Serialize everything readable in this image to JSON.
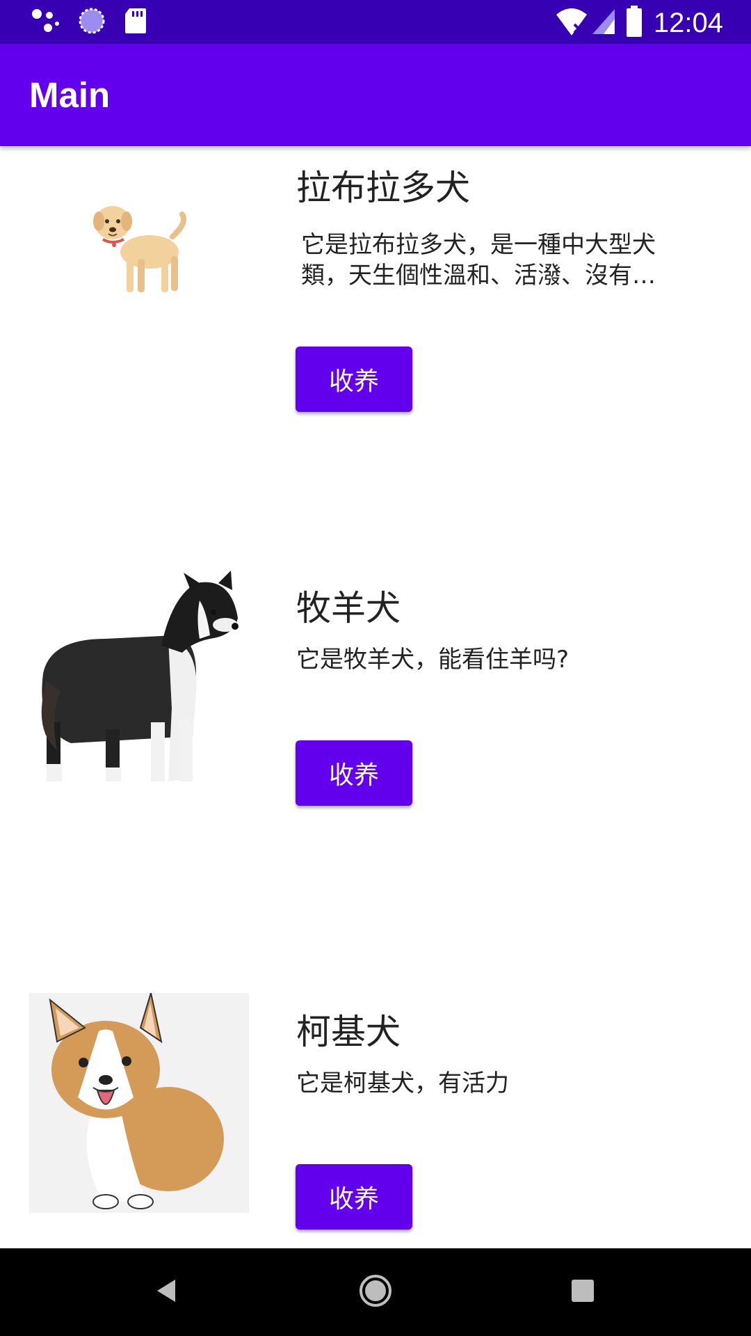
{
  "status_bar": {
    "time": "12:04",
    "icons_left": [
      "assistant-dots-icon",
      "loading-circle-icon",
      "sd-card-icon"
    ],
    "icons_right": [
      "wifi-x-icon",
      "signal-icon",
      "battery-icon"
    ]
  },
  "app_bar": {
    "title": "Main"
  },
  "dogs": [
    {
      "name": "拉布拉多犬",
      "description": "它是拉布拉多犬，是一種中大型犬類，天生個性溫和、活潑、沒有…",
      "button": "收养",
      "image": "labrador-image"
    },
    {
      "name": "牧羊犬",
      "description": "它是牧羊犬，能看住羊吗?",
      "button": "收养",
      "image": "collie-image"
    },
    {
      "name": "柯基犬",
      "description": "它是柯基犬，有活力",
      "button": "收养",
      "image": "corgi-image"
    }
  ],
  "nav_bar": {
    "buttons": [
      "back-icon",
      "home-icon",
      "recents-icon"
    ]
  },
  "colors": {
    "primary": "#6200ee",
    "primary_dark": "#3700b3",
    "text": "#222222"
  }
}
